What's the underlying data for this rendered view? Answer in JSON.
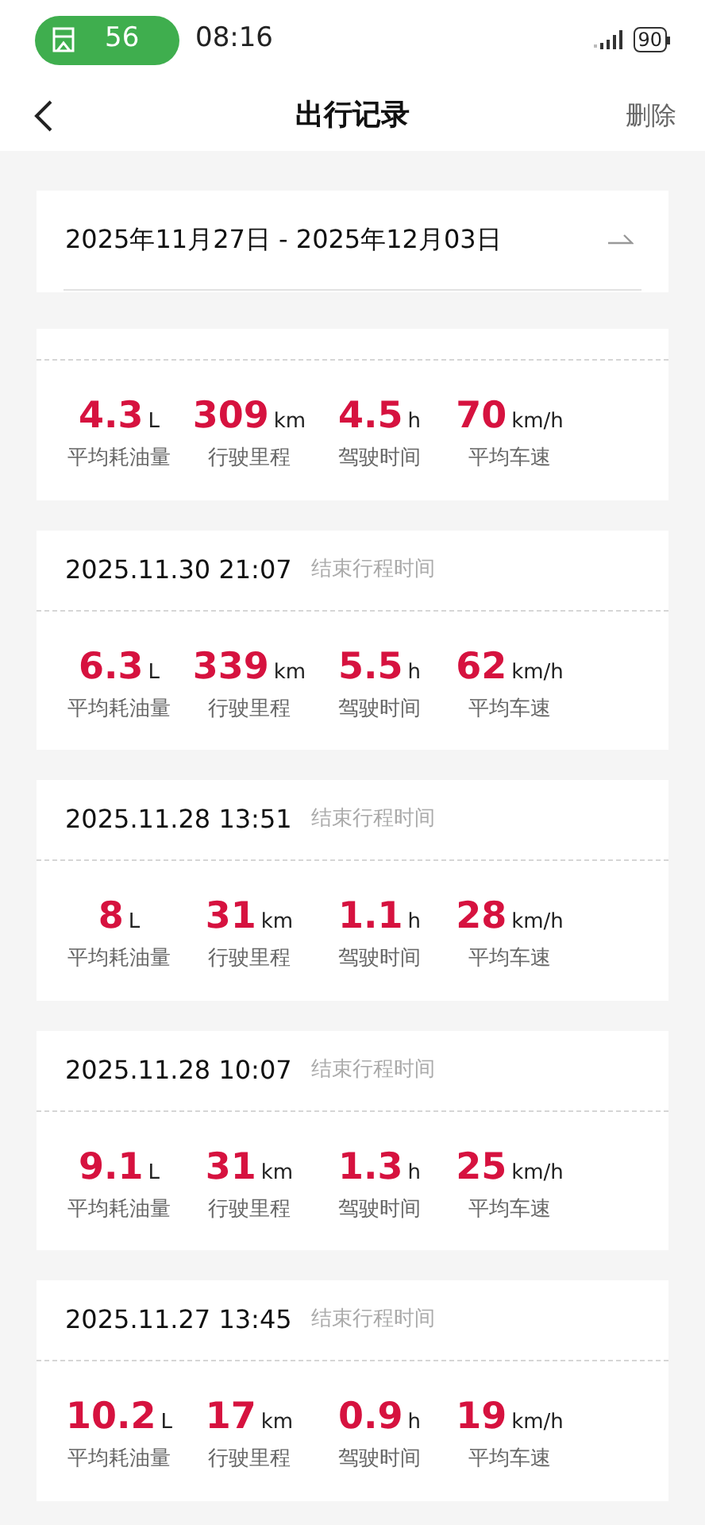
{
  "status_bar": {
    "badge_count": "56",
    "time": "08:16",
    "battery": "90"
  },
  "nav": {
    "title": "出行记录",
    "action": "删除"
  },
  "date_range": {
    "text": "2025年11月27日 - 2025年12月03日"
  },
  "trips": [
    {
      "stats": [
        {
          "value": "4.3",
          "unit": "L",
          "label": "平均耗油量"
        },
        {
          "value": "309",
          "unit": "km",
          "label": "行驶里程"
        },
        {
          "value": "4.5",
          "unit": "h",
          "label": "驾驶时间"
        },
        {
          "value": "70",
          "unit": "km/h",
          "label": "平均车速"
        }
      ]
    },
    {
      "end_time": "2025.11.30 21:07",
      "end_label": "结束行程时间",
      "stats": [
        {
          "value": "6.3",
          "unit": "L",
          "label": "平均耗油量"
        },
        {
          "value": "339",
          "unit": "km",
          "label": "行驶里程"
        },
        {
          "value": "5.5",
          "unit": "h",
          "label": "驾驶时间"
        },
        {
          "value": "62",
          "unit": "km/h",
          "label": "平均车速"
        }
      ]
    },
    {
      "end_time": "2025.11.28 13:51",
      "end_label": "结束行程时间",
      "stats": [
        {
          "value": "8",
          "unit": "L",
          "label": "平均耗油量"
        },
        {
          "value": "31",
          "unit": "km",
          "label": "行驶里程"
        },
        {
          "value": "1.1",
          "unit": "h",
          "label": "驾驶时间"
        },
        {
          "value": "28",
          "unit": "km/h",
          "label": "平均车速"
        }
      ]
    },
    {
      "end_time": "2025.11.28 10:07",
      "end_label": "结束行程时间",
      "stats": [
        {
          "value": "9.1",
          "unit": "L",
          "label": "平均耗油量"
        },
        {
          "value": "31",
          "unit": "km",
          "label": "行驶里程"
        },
        {
          "value": "1.3",
          "unit": "h",
          "label": "驾驶时间"
        },
        {
          "value": "25",
          "unit": "km/h",
          "label": "平均车速"
        }
      ]
    },
    {
      "end_time": "2025.11.27 13:45",
      "end_label": "结束行程时间",
      "stats": [
        {
          "value": "10.2",
          "unit": "L",
          "label": "平均耗油量"
        },
        {
          "value": "17",
          "unit": "km",
          "label": "行驶里程"
        },
        {
          "value": "0.9",
          "unit": "h",
          "label": "驾驶时间"
        },
        {
          "value": "19",
          "unit": "km/h",
          "label": "平均车速"
        }
      ]
    }
  ]
}
